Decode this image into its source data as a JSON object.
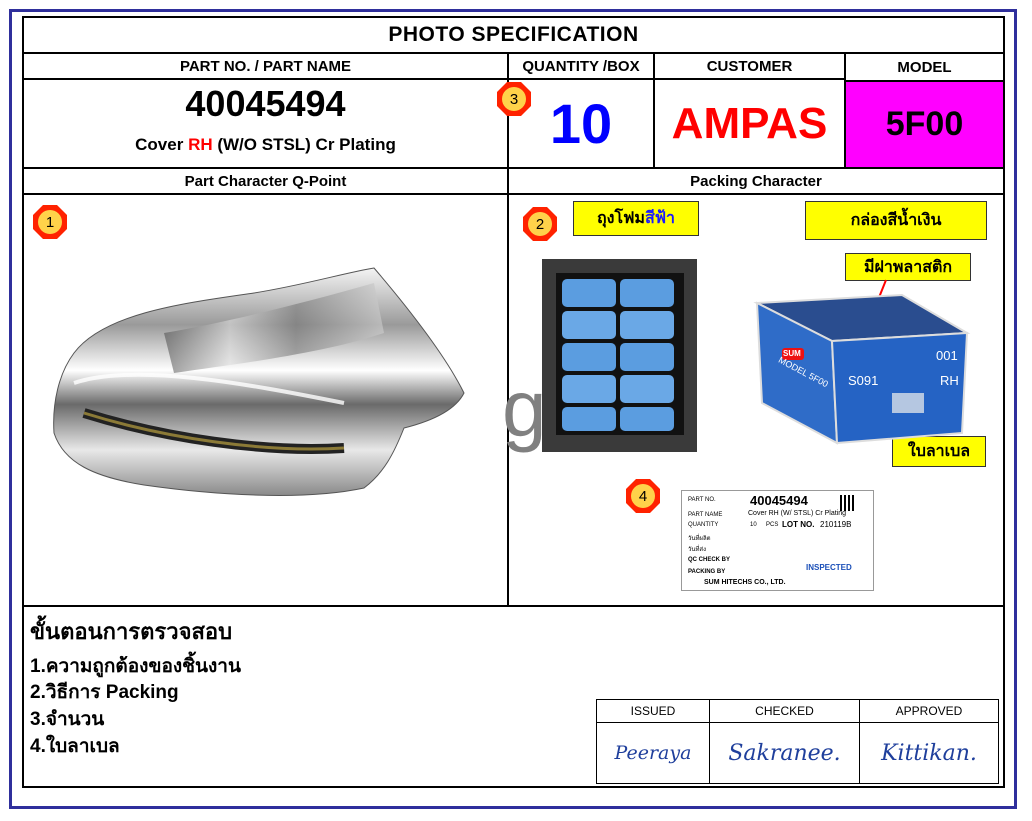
{
  "header": {
    "title": "PHOTO  SPECIFICATION",
    "col_part": "PART NO. / PART NAME",
    "col_qty": "QUANTITY /BOX",
    "col_customer": "CUSTOMER",
    "col_model": "MODEL"
  },
  "part": {
    "number": "40045494",
    "name_prefix": "Cover ",
    "name_highlight": "RH",
    "name_suffix": " (W/O STSL) Cr Plating"
  },
  "quantity": "10",
  "customer": "AMPAS",
  "model": "5F00",
  "sections": {
    "left": "Part Character Q-Point",
    "right": "Packing Character"
  },
  "badges": [
    "1",
    "2",
    "3",
    "4"
  ],
  "callouts": {
    "foam_bag_prefix": "ถุงโฟม",
    "foam_bag_blue": "สีฟ้า",
    "blue_box": "กล่องสีน้ำเงิน",
    "plastic_lid": "มีฝาพลาสติก",
    "label": "ใบลาเบล"
  },
  "watermark": "g",
  "box_print": {
    "logo": "SUM",
    "model_text": "MODEL  5F00",
    "code": "S091",
    "number": "001",
    "side": "RH"
  },
  "label_card": {
    "part_no_label": "PART NO.",
    "part_no": "40045494",
    "part_name_label": "PART NAME",
    "part_name": "Cover RH (W/ STSL) Cr Plating",
    "quantity_label": "QUANTITY",
    "quantity": "10",
    "quantity_unit": "PCS",
    "lot_label": "LOT NO.",
    "lot": "210119B",
    "receive_label": "วันที่ผลิต",
    "ship_label": "วันที่ส่ง",
    "qc_label": "QC CHECK BY",
    "packing_label": "PACKING BY",
    "stamp": "INSPECTED",
    "company": "SUM HITECHS CO., LTD."
  },
  "steps": {
    "title": "ขั้นตอนการตรวจสอบ",
    "items": [
      "1.ความถูกต้องของชิ้นงาน",
      "2.วิธีการ Packing",
      "3.จำนวน",
      "4.ใบลาเบล"
    ]
  },
  "approval": {
    "issued_label": "ISSUED",
    "checked_label": "CHECKED",
    "approved_label": "APPROVED",
    "issued_sig": "Peeraya",
    "checked_sig": "Sakranee.",
    "approved_sig": "Kittikan."
  },
  "colors": {
    "frame": "#2f2f9c",
    "quantity": "#0000ff",
    "customer": "#ff0000",
    "model_bg": "#ff00ff",
    "badge": "#ff0000",
    "callout_bg": "#ffff00"
  }
}
